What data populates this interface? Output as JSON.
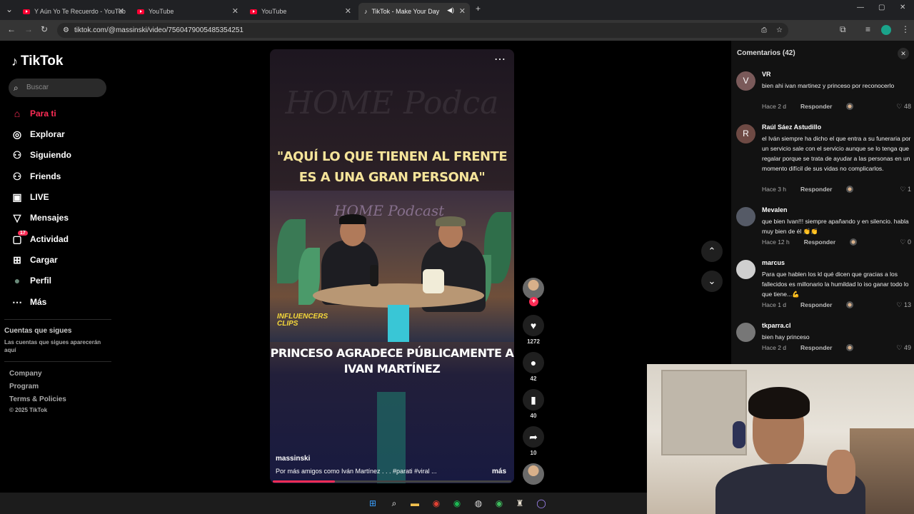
{
  "browser": {
    "tabs": [
      {
        "title": "Y Aún Yo Te Recuerdo - YouTub",
        "icon": "youtube-icon"
      },
      {
        "title": "YouTube",
        "icon": "youtube-icon"
      },
      {
        "title": "YouTube",
        "icon": "youtube-icon"
      },
      {
        "title": "TikTok - Make Your Day",
        "icon": "tiktok-icon"
      }
    ],
    "url": "tiktok.com/@massinski/video/7560479005485354251"
  },
  "sidebar": {
    "logo": "TikTok",
    "search_placeholder": "Buscar",
    "nav": [
      {
        "label": "Para ti",
        "icon": "home-icon",
        "glyph": "⌂"
      },
      {
        "label": "Explorar",
        "icon": "compass-icon",
        "glyph": "◎"
      },
      {
        "label": "Siguiendo",
        "icon": "following-icon",
        "glyph": "⚇"
      },
      {
        "label": "Friends",
        "icon": "friends-icon",
        "glyph": "⚇"
      },
      {
        "label": "LIVE",
        "icon": "live-icon",
        "glyph": "▣"
      },
      {
        "label": "Mensajes",
        "icon": "messages-icon",
        "glyph": "▽"
      },
      {
        "label": "Actividad",
        "icon": "activity-icon",
        "glyph": "▢",
        "badge": "17"
      },
      {
        "label": "Cargar",
        "icon": "upload-icon",
        "glyph": "⊞"
      },
      {
        "label": "Perfil",
        "icon": "profile-avatar-icon",
        "glyph": "●"
      },
      {
        "label": "Más",
        "icon": "more-icon",
        "glyph": "⋯"
      }
    ],
    "following_title": "Cuentas que sigues",
    "following_sub": "Las cuentas que sigues aparecerán aquí",
    "footer": [
      "Company",
      "Program",
      "Terms & Policies"
    ],
    "copyright": "© 2025 TikTok"
  },
  "video": {
    "top_caption": "\"AQUÍ LO QUE TIENEN AL FRENTE ES A UNA GRAN PERSONA\"",
    "bottom_caption": "PRINCESO AGRADECE PÚBLICAMENTE A IVAN MARTÍNEZ",
    "watermark": "INFLUENCERS CLIPS",
    "author": "massinski",
    "description": "Por más amigos como Iván Martínez . . . #parati  #viral  ...",
    "more": "más",
    "progress": 0.26
  },
  "actions": {
    "likes": "1272",
    "comments": "42",
    "saves": "40",
    "shares": "10"
  },
  "comments_panel": {
    "title": "Comentarios (42)",
    "items": [
      {
        "user": "VR",
        "initial": "V",
        "avatar_color": "#7a5a5a",
        "text": "bien ahi ivan martinez y princeso por reconocerlo",
        "time": "Hace 2 d",
        "reply": "Responder",
        "likes": "48"
      },
      {
        "user": "Raúl Sáez Astudillo",
        "initial": "R",
        "avatar_color": "#6e4a44",
        "text": "el Iván siempre ha dicho el que entra a su funeraria por un servicio sale con el servicio aunque se lo tenga que regalar porque se trata de ayudar a las personas en un momento difícil de sus vidas no complicarlos.",
        "time": "Hace 3 h",
        "reply": "Responder",
        "likes": "1"
      },
      {
        "user": "Mevalen",
        "initial": "",
        "avatar_color": "#555a66",
        "text": "que bien Ivan!!! siempre apañando y en silencio. habla muy bien de él 👏👏",
        "time": "Hace 12 h",
        "reply": "Responder",
        "likes": "0"
      },
      {
        "user": "marcus",
        "initial": "",
        "avatar_color": "#cfcfcf",
        "text": "Para que hablen los kl qué dicen que gracias a los fallecidos es millonario la humildad lo iso ganar todo lo que tiene...💪",
        "time": "Hace 1 d",
        "reply": "Responder",
        "likes": "13"
      },
      {
        "user": "tkparra.cl",
        "initial": "",
        "avatar_color": "#777",
        "text": "bien hay princeso",
        "time": "Hace 2 d",
        "reply": "Responder",
        "likes": "49"
      }
    ]
  },
  "colors": {
    "accent": "#fe2c55",
    "caption_yellow": "#f5e49a"
  }
}
